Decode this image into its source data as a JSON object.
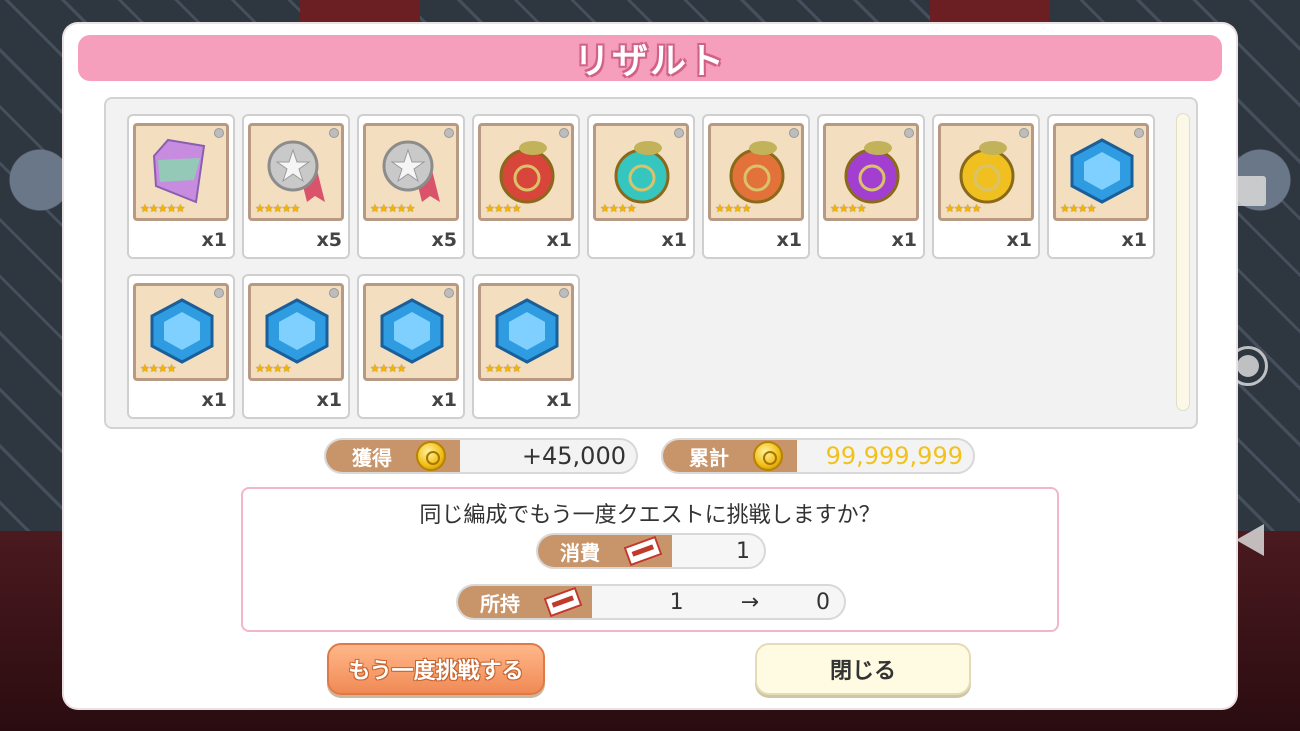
{
  "title": "リザルト",
  "items": [
    {
      "icon": "rainbow-crystal-icon",
      "color": "#c78ce0",
      "stars": "★★★★★",
      "qty": "x1"
    },
    {
      "icon": "silver-medal-icon",
      "color": "#c9c9c9",
      "stars": "★★★★★",
      "qty": "x5"
    },
    {
      "icon": "silver-medal-icon",
      "color": "#c9c9c9",
      "stars": "★★★★★",
      "qty": "x5"
    },
    {
      "icon": "red-orb-icon",
      "color": "#d8453a",
      "stars": "★★★★",
      "qty": "x1"
    },
    {
      "icon": "teal-orb-icon",
      "color": "#35c6c0",
      "stars": "★★★★",
      "qty": "x1"
    },
    {
      "icon": "orange-orb-icon",
      "color": "#e2713a",
      "stars": "★★★★",
      "qty": "x1"
    },
    {
      "icon": "purple-orb-icon",
      "color": "#a23fd1",
      "stars": "★★★★",
      "qty": "x1"
    },
    {
      "icon": "yellow-orb-icon",
      "color": "#f0c020",
      "stars": "★★★★",
      "qty": "x1"
    },
    {
      "icon": "blue-hex-gem-icon",
      "color": "#2f9be0",
      "stars": "★★★★",
      "qty": "x1"
    },
    {
      "icon": "blue-hex-gem-icon",
      "color": "#2f9be0",
      "stars": "★★★★",
      "qty": "x1"
    },
    {
      "icon": "blue-hex-gem-icon",
      "color": "#2f9be0",
      "stars": "★★★★",
      "qty": "x1"
    },
    {
      "icon": "blue-hex-gem-icon",
      "color": "#2f9be0",
      "stars": "★★★★",
      "qty": "x1"
    },
    {
      "icon": "blue-hex-gem-icon",
      "color": "#2f9be0",
      "stars": "★★★★",
      "qty": "x1"
    }
  ],
  "earned": {
    "label": "獲得",
    "value": "+45,000"
  },
  "total": {
    "label": "累計",
    "value": "99,999,999"
  },
  "retry": {
    "question": "同じ編成でもう一度クエストに挑戦しますか？",
    "cost_label": "消費",
    "cost_value": "1",
    "owned_label": "所持",
    "owned_value": "1 → 0"
  },
  "buttons": {
    "retry": "もう一度挑戦する",
    "close": "閉じる"
  }
}
